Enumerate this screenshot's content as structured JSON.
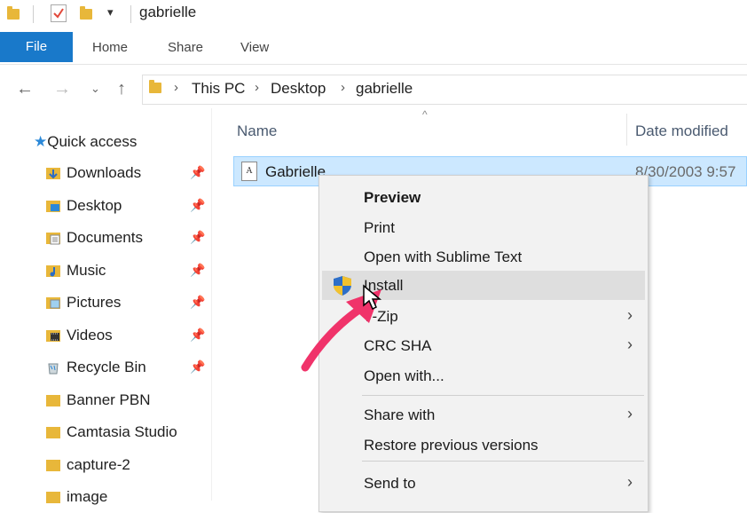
{
  "window": {
    "title": "gabrielle"
  },
  "ribbon": {
    "tabs": [
      "File",
      "Home",
      "Share",
      "View"
    ]
  },
  "address": {
    "crumbs": [
      "This PC",
      "Desktop",
      "gabrielle"
    ]
  },
  "sidebar": {
    "quick_access": "Quick access",
    "items": [
      {
        "label": "Downloads",
        "icon": "downloads-icon",
        "pinned": true
      },
      {
        "label": "Desktop",
        "icon": "desktop-icon",
        "pinned": true
      },
      {
        "label": "Documents",
        "icon": "documents-icon",
        "pinned": true
      },
      {
        "label": "Music",
        "icon": "music-icon",
        "pinned": true
      },
      {
        "label": "Pictures",
        "icon": "pictures-icon",
        "pinned": true
      },
      {
        "label": "Videos",
        "icon": "videos-icon",
        "pinned": true
      },
      {
        "label": "Recycle Bin",
        "icon": "recycle-bin-icon",
        "pinned": true
      },
      {
        "label": "Banner PBN",
        "icon": "folder-icon",
        "pinned": false
      },
      {
        "label": "Camtasia Studio",
        "icon": "folder-icon",
        "pinned": false
      },
      {
        "label": "capture-2",
        "icon": "folder-icon",
        "pinned": false
      },
      {
        "label": "image",
        "icon": "folder-icon",
        "pinned": false
      }
    ]
  },
  "filelist": {
    "columns": {
      "name": "Name",
      "date": "Date modified"
    },
    "rows": [
      {
        "name": "Gabrielle",
        "date": "8/30/2003 9:57"
      }
    ]
  },
  "context_menu": {
    "items": [
      {
        "label": "Preview",
        "bold": true
      },
      {
        "label": "Print"
      },
      {
        "label": "Open with Sublime Text"
      },
      {
        "label": "Install",
        "icon": "uac-shield-icon",
        "hover": true
      },
      {
        "label": "7-Zip",
        "submenu": true
      },
      {
        "label": "CRC SHA",
        "submenu": true
      },
      {
        "label": "Open with..."
      },
      {
        "label": "Share with",
        "submenu": true
      },
      {
        "label": "Restore previous versions"
      },
      {
        "label": "Send to",
        "submenu": true
      }
    ]
  },
  "colors": {
    "accent": "#1979ca",
    "selection": "#cce8ff",
    "annotation_arrow": "#f0336a",
    "folder": "#e8b73a"
  }
}
